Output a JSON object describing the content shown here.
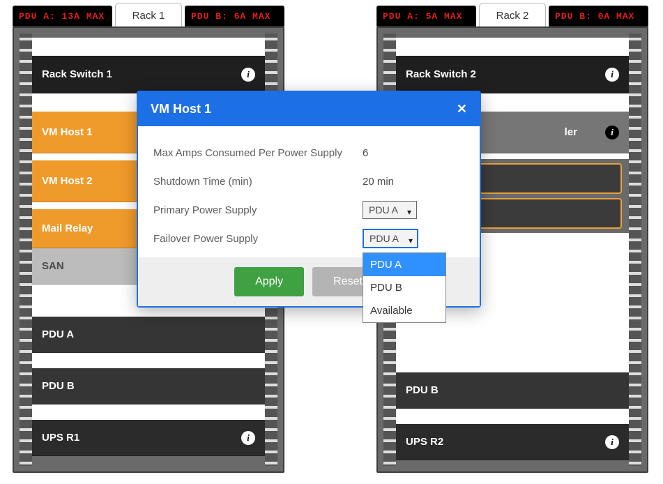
{
  "racks": [
    {
      "tab": "Rack 1",
      "pdu_a": "PDU A: 13A MAX",
      "pdu_b": "PDU B: 6A MAX",
      "units": {
        "switch": "Rack Switch 1",
        "vmhost1": "VM Host 1",
        "vmhost2": "VM Host 2",
        "mailrelay": "Mail Relay",
        "san": "SAN",
        "pdua": "PDU A",
        "pdub": "PDU B",
        "ups": "UPS R1"
      }
    },
    {
      "tab": "Rack 2",
      "pdu_a": "PDU A: 5A MAX",
      "pdu_b": "PDU B: 0A MAX",
      "units": {
        "switch": "Rack Switch 2",
        "controller_suffix": "ler",
        "pdub": "PDU B",
        "ups": "UPS R2"
      }
    }
  ],
  "modal": {
    "title": "VM Host 1",
    "rows": {
      "maxamps_label": "Max Amps Consumed Per Power Supply",
      "maxamps_value": "6",
      "shutdown_label": "Shutdown Time (min)",
      "shutdown_value": "20 min",
      "primary_label": "Primary Power Supply",
      "primary_value": "PDU A",
      "failover_label": "Failover Power Supply",
      "failover_value": "PDU A"
    },
    "dropdown": {
      "opt1": "PDU A",
      "opt2": "PDU B",
      "opt3": "Available"
    },
    "buttons": {
      "apply": "Apply",
      "reset": "Reset"
    }
  }
}
